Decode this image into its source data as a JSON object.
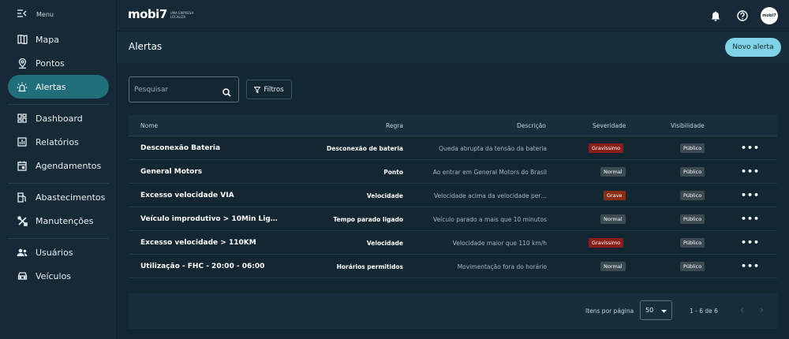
{
  "sidebar": {
    "menu_label": "Menu",
    "items": [
      {
        "label": "Mapa",
        "icon": "map-icon"
      },
      {
        "label": "Pontos",
        "icon": "location-pin-icon"
      },
      {
        "label": "Alertas",
        "icon": "siren-icon",
        "active": true
      },
      {
        "label": "Dashboard",
        "icon": "dashboard-icon"
      },
      {
        "label": "Relatórios",
        "icon": "report-icon"
      },
      {
        "label": "Agendamentos",
        "icon": "calendar-icon"
      },
      {
        "label": "Abastecimentos",
        "icon": "fuel-pump-icon"
      },
      {
        "label": "Manutenções",
        "icon": "tools-icon"
      },
      {
        "label": "Usuários",
        "icon": "users-icon"
      },
      {
        "label": "Veículos",
        "icon": "car-icon"
      }
    ]
  },
  "topbar": {
    "logo_text": "mobi7",
    "logo_subtitle": "UMA EMPRESA LOCALIZA",
    "avatar_text": "mobi7"
  },
  "header": {
    "title": "Alertas",
    "new_button": "Novo alerta"
  },
  "toolbar": {
    "search_placeholder": "Pesquisar",
    "filter_label": "Filtros"
  },
  "table": {
    "columns": {
      "name": "Nome",
      "rule": "Regra",
      "description": "Descrição",
      "severity": "Severidade",
      "visibility": "Visibilidade"
    },
    "rows": [
      {
        "name": "Desconexão Bateria",
        "rule": "Desconexão de bateria",
        "description": "Queda abrupta da tensão da bateria",
        "severity": "Gravíssimo",
        "visibility": "Público"
      },
      {
        "name": "General Motors",
        "rule": "Ponto",
        "description": "Ao entrar em General Motors do Brasil",
        "severity": "Normal",
        "visibility": "Público"
      },
      {
        "name": "Excesso velocidade VIA",
        "rule": "Velocidade",
        "description": "Velocidade acima da velocidade per…",
        "severity": "Grave",
        "visibility": "Público"
      },
      {
        "name": "Veículo improdutivo > 10Min Lig…",
        "rule": "Tempo parado ligado",
        "description": "Veículo parado a mais que 10 minutos",
        "severity": "Normal",
        "visibility": "Público"
      },
      {
        "name": "Excesso velocidade > 110KM",
        "rule": "Velocidade",
        "description": "Velocidade maior que 110 km/h",
        "severity": "Gravíssimo",
        "visibility": "Público"
      },
      {
        "name": "Utilização - FHC - 20:00 - 06:00",
        "rule": "Horários permitidos",
        "description": "Movimentação fora do horário",
        "severity": "Normal",
        "visibility": "Público"
      }
    ]
  },
  "pagination": {
    "items_label": "Itens por página",
    "page_size": "50",
    "range": "1 - 6 de 6"
  },
  "colors": {
    "accent": "#7fd3e6",
    "active_nav": "#1f6e79",
    "severity_gravissimo": "#8a1f1a",
    "severity_grave": "#8a2d10",
    "severity_normal": "#3c4a52"
  }
}
